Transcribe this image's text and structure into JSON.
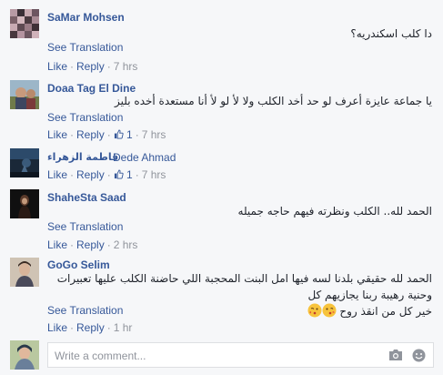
{
  "comments": [
    {
      "name": "SaMar Mohsen",
      "text": "دا كلب اسكندريه؟",
      "see_translation": "See Translation",
      "like": "Like",
      "reply": "Reply",
      "time": "7 hrs"
    },
    {
      "name": "Doaa Tag El Dine",
      "text": "يا جماعة عايزة أعرف لو حد أخد الكلب ولا لأ لو لأ أنا مستعدة أخده بليز",
      "see_translation": "See Translation",
      "like": "Like",
      "reply": "Reply",
      "likes": "1",
      "time": "7 hrs"
    },
    {
      "name": "فاطمة الزهراء",
      "name2": "Dede Ahmad",
      "like": "Like",
      "reply": "Reply",
      "likes": "1",
      "time": "7 hrs"
    },
    {
      "name": "ShaheSta Saad",
      "text": "الحمد لله.. الكلب ونظرته فيهم حاجه جميله",
      "see_translation": "See Translation",
      "like": "Like",
      "reply": "Reply",
      "time": "2 hrs"
    },
    {
      "name": "GoGo Selim",
      "text_line1": "الحمد لله حقيقي بلدنا لسه فيها امل البنت المحجبة اللي حاضنة الكلب عليها تعبيرات وحنية رهيبة ربنا يجازيهم كل",
      "text_line2": "خير كل من انقذ روح",
      "see_translation": "See Translation",
      "like": "Like",
      "reply": "Reply",
      "time": "1 hr"
    }
  ],
  "composer": {
    "placeholder": "Write a comment..."
  },
  "icons": {
    "like": "thumbs-up-icon",
    "camera": "camera-icon",
    "emoji": "smiley-icon"
  },
  "colors": {
    "link": "#365899",
    "meta": "#90949c",
    "background": "#f6f7f9"
  }
}
